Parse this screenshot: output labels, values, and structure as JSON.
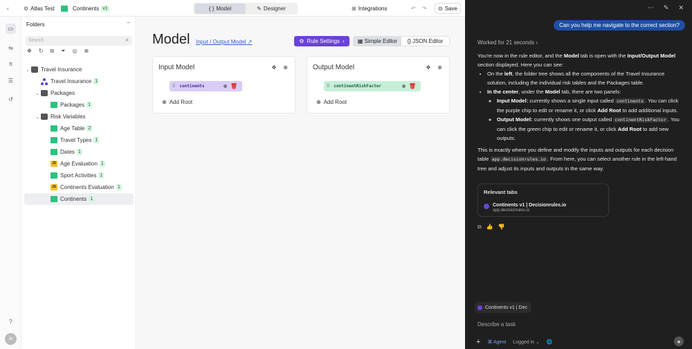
{
  "topbar": {
    "project": "Atlas Test",
    "rule_name": "Continents",
    "version": "v1",
    "tabs": [
      {
        "label": "Model"
      },
      {
        "label": "Designer"
      }
    ],
    "integrations": "Integrations",
    "save": "Save"
  },
  "sidebar": {
    "title": "Folders",
    "search_placeholder": "Search",
    "tree": [
      {
        "label": "Travel Insurance",
        "type": "folder"
      },
      {
        "label": "Travel Insurance",
        "type": "flow",
        "count": "1"
      },
      {
        "label": "Packages",
        "type": "folder"
      },
      {
        "label": "Packages",
        "type": "table",
        "count": "1"
      },
      {
        "label": "Risk Variables",
        "type": "folder"
      },
      {
        "label": "Age Table",
        "type": "table",
        "count": "2"
      },
      {
        "label": "Travel Types",
        "type": "table",
        "count": "1"
      },
      {
        "label": "Dates",
        "type": "table",
        "count": "1"
      },
      {
        "label": "Age Evaluation",
        "type": "js",
        "count": "1"
      },
      {
        "label": "Sport Activities",
        "type": "table",
        "count": "1"
      },
      {
        "label": "Continents Evaluation",
        "type": "js",
        "count": "1"
      },
      {
        "label": "Continents",
        "type": "table",
        "count": "1"
      }
    ],
    "user_initials": "JK"
  },
  "main": {
    "title": "Model",
    "io_link": "Input / Output Model",
    "rule_settings": "Rule Settings",
    "simple_editor": "Simple Editor",
    "json_editor": "JSON Editor",
    "input_panel": {
      "title": "Input Model",
      "chip": "continents",
      "add_root": "Add Root"
    },
    "output_panel": {
      "title": "Output Model",
      "chip": "continentRiskFactor",
      "add_root": "Add Root"
    }
  },
  "chat": {
    "user_message": "Can you help me navigate to the correct section?",
    "worked": "Worked for 21 seconds",
    "p1a": "You're now in the rule editor, and the ",
    "p1b": "Model",
    "p1c": " tab is open with the ",
    "p1d": "Input/Output Model",
    "p1e": " section displayed. Here you can see:",
    "li1a": "On the ",
    "li1b": "left",
    "li1c": ", the folder tree shows all the components of the Travel Insurance solution, including the individual risk tables and the Packages table.",
    "li2a": "In the center",
    "li2b": ", under the ",
    "li2c": "Model",
    "li2d": " tab, there are two panels:",
    "in_a": "Input Model:",
    "in_b": " currently shows a single input called ",
    "in_code": "continents",
    "in_c": ". You can click the purple chip to edit or rename it, or click ",
    "in_d": "Add Root",
    "in_e": " to add additional inputs.",
    "out_a": "Output Model:",
    "out_b": " currently shows one output called ",
    "out_code": "continentRiskFactor",
    "out_c": ". You can click the green chip to edit or rename it, or click ",
    "out_d": "Add Root",
    "out_e": " to add new outputs.",
    "p2a": "This is exactly where you define and modify the inputs and outputs for each decision table ",
    "p2link": "app.decisionrules.io",
    "p2b": ". From here, you can select another rule in the left-hand tree and adjust its inputs and outputs in the same way.",
    "relevant_title": "Relevant tabs",
    "relevant_tab": "Continents v1 | Decisionrules.io",
    "relevant_url": "app.decisionrules.io",
    "tab_chip": "Continents v1 | Dec",
    "task_placeholder": "Describe a task",
    "agent": "Agent",
    "logged_in": "Logged in"
  },
  "colors": {
    "accent": "#6a42d8",
    "green": "#2cc27e",
    "chat_bg": "#1f1f1f"
  }
}
